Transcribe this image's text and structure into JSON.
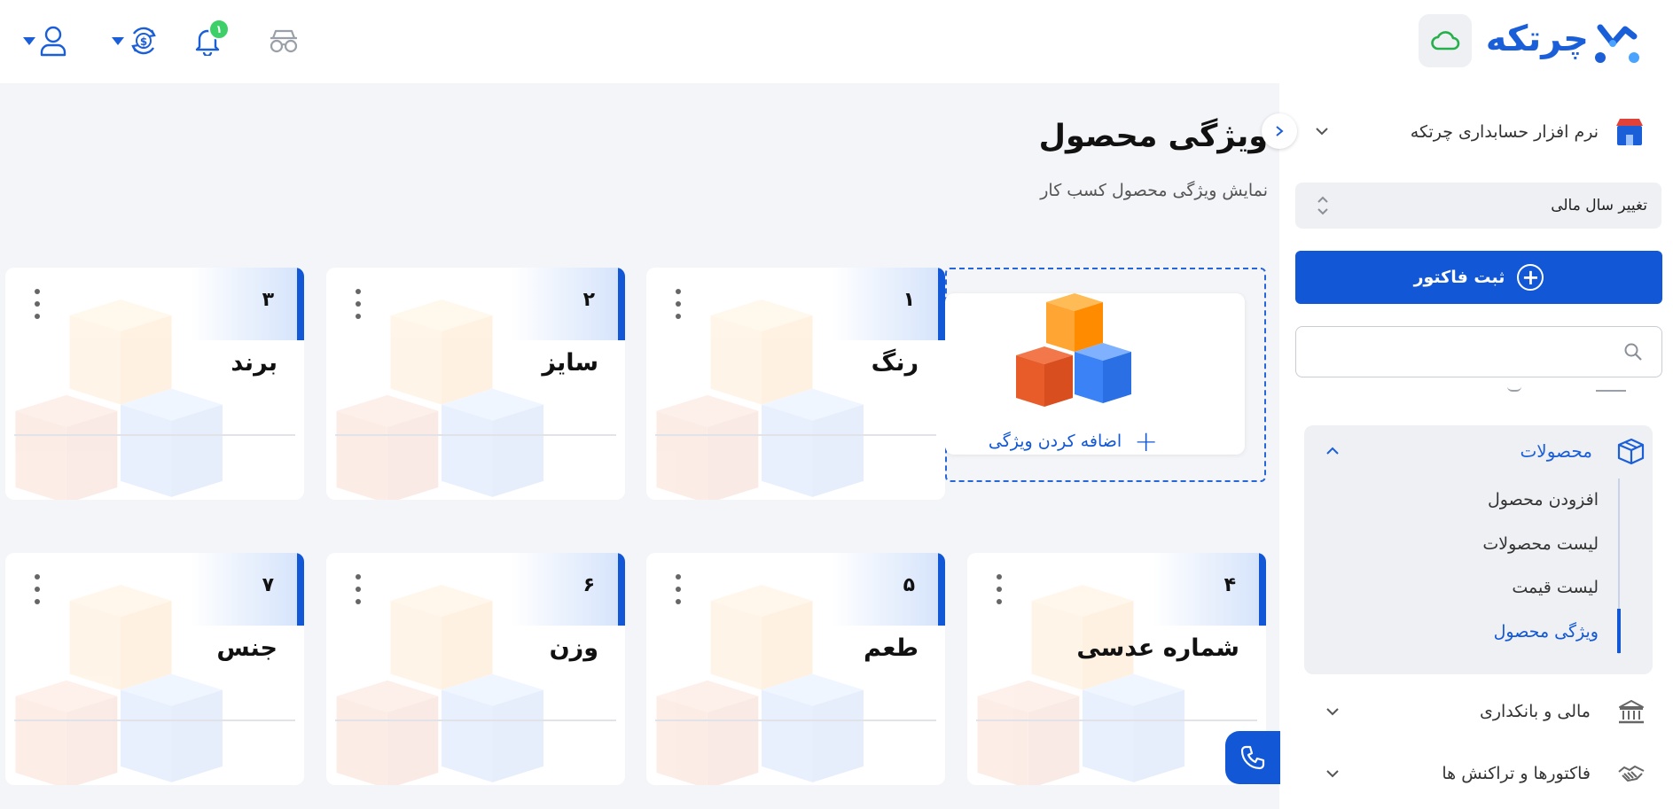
{
  "app": {
    "logo_text": "چرتکه",
    "brand_color": "#1258d6",
    "accent_green": "#3dd068"
  },
  "topbar": {
    "notifications_count": "۱",
    "icons": [
      "cloud-icon",
      "glasses-icon",
      "bell-icon",
      "exchange-icon",
      "user-icon"
    ]
  },
  "sidebar": {
    "company": "نرم افزار حسابداری چرتکه",
    "fiscal_year": "تغییر سال مالی",
    "invoice_button": "ثبت فاکتور",
    "search_placeholder": "",
    "products": {
      "label": "محصولات",
      "items": [
        {
          "label": "افزودن محصول"
        },
        {
          "label": "لیست محصولات"
        },
        {
          "label": "لیست قیمت"
        },
        {
          "label": "ویژگی محصول"
        }
      ]
    },
    "finance": "مالی و بانکداری",
    "invoices": "فاکتورها و تراکنش ها"
  },
  "main": {
    "title": "ویژگی محصول",
    "subtitle": "نمایش ویژگی محصول کسب کار",
    "add_label": "اضافه کردن ویژگی",
    "cards": [
      {
        "num": "۱",
        "name": "رنگ"
      },
      {
        "num": "۲",
        "name": "سایز"
      },
      {
        "num": "۳",
        "name": "برند"
      },
      {
        "num": "۴",
        "name": "شماره عدسی"
      },
      {
        "num": "۵",
        "name": "طعم"
      },
      {
        "num": "۶",
        "name": "وزن"
      },
      {
        "num": "۷",
        "name": "جنس"
      }
    ]
  }
}
